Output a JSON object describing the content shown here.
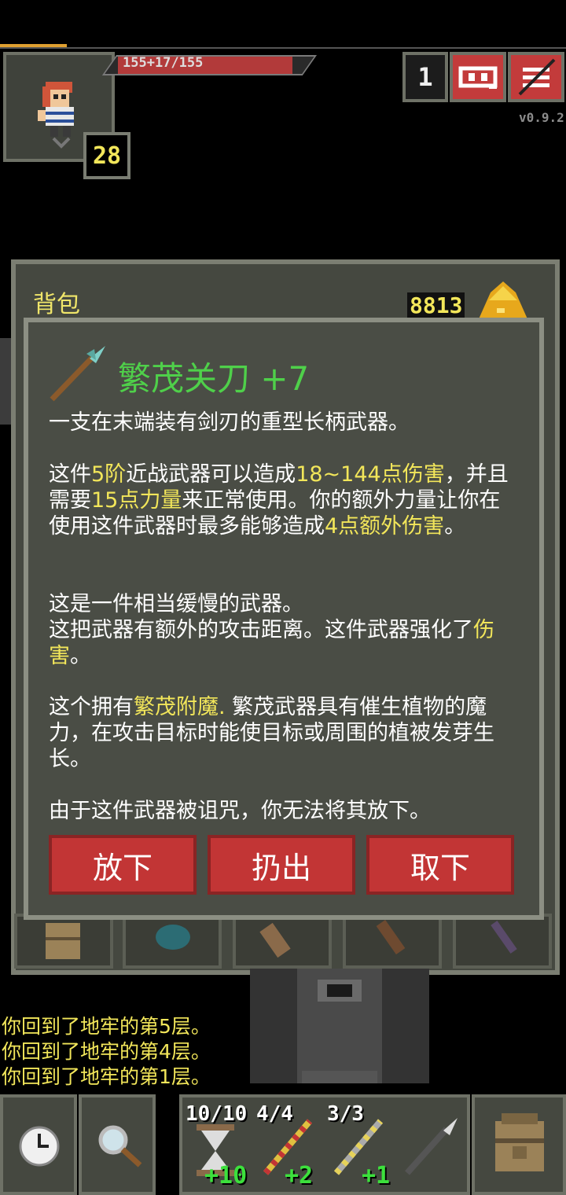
{
  "hero": {
    "hp_text": "155+17/155",
    "hp_fraction": 1.0,
    "level": "28",
    "depth": "1",
    "version": "v0.9.2"
  },
  "bag": {
    "title": "背包",
    "gold": "8813"
  },
  "item": {
    "name": "繁茂关刀 +7",
    "desc1": "一支在末端装有剑刃的重型长柄武器。",
    "p2": {
      "a": "这件",
      "tier": "5阶",
      "b": "近战武器可以造成",
      "dmg": "18~144点伤害",
      "c": "，并且需要",
      "str": "15点力量",
      "d": "来正常使用。你的额外力量让你在使用这件武器时最多能够造成",
      "bonus": "4点额外伤害",
      "e": "。"
    },
    "p3_line1": "这是一件相当缓慢的武器。",
    "p3_line2a": "这把武器有额外的攻击距离。这件武器强化了",
    "p3_hl": "伤害",
    "p3_line2b": "。",
    "p4": {
      "a": "这个拥有",
      "ench": "繁茂附魔.",
      "b": " 繁茂武器具有催生植物的魔力，在攻击目标时能使目标或周围的植被发芽生长。"
    },
    "p5": "由于这件武器被诅咒，你无法将其放下。",
    "buttons": {
      "drop": "放下",
      "throw": "扔出",
      "unequip": "取下"
    }
  },
  "log": [
    "你回到了地牢的第5层。",
    "你回到了地牢的第4层。",
    "你回到了地牢的第1层。"
  ],
  "toolbar": {
    "quickslots": [
      {
        "count": "10/10",
        "bonus": "+10",
        "icon": "hourglass-icon"
      },
      {
        "count": "4/4",
        "bonus": "+2",
        "icon": "wand-red-icon"
      },
      {
        "count": "3/3",
        "bonus": "+1",
        "icon": "wand-yellow-icon"
      },
      {
        "count": "",
        "bonus": "",
        "icon": "spear-icon"
      }
    ]
  },
  "colors": {
    "highlight": "#f2e65a",
    "item_name": "#4fd04a",
    "button": "#c23535",
    "panel": "#454840"
  }
}
